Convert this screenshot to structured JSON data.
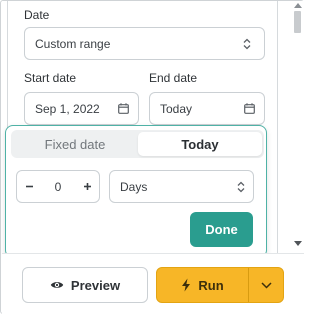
{
  "form": {
    "date_label": "Date",
    "date_select_value": "Custom range",
    "start_date_label": "Start date",
    "start_date_value": "Sep 1, 2022",
    "end_date_label": "End date",
    "end_date_value": "Today"
  },
  "popover": {
    "tab_fixed": "Fixed date",
    "tab_today": "Today",
    "active_tab": "Today",
    "offset_value": "0",
    "unit_value": "Days",
    "done_label": "Done"
  },
  "footer": {
    "preview_label": "Preview",
    "run_label": "Run"
  },
  "icons": {
    "select": "chevron-updown-icon",
    "calendar": "calendar-icon",
    "eye": "eye-icon",
    "bolt": "lightning-bolt-icon",
    "caret": "chevron-down-icon"
  },
  "colors": {
    "accent_teal": "#2a9d8f",
    "run_yellow": "#f7b627",
    "popover_border": "#4fb2a6"
  }
}
